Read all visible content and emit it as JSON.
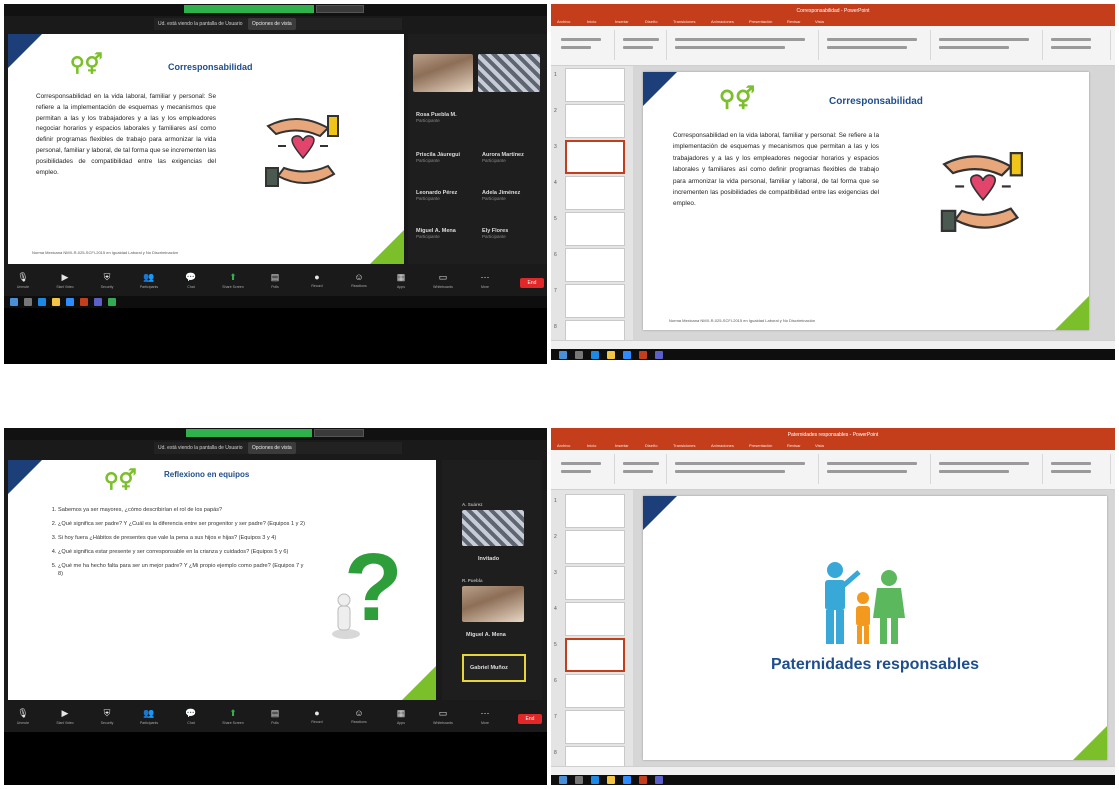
{
  "top": {
    "zoom": {
      "share_bar": {
        "text": "Ud. está viendo la pantalla de Usuario",
        "pill": "Opciones de vista"
      },
      "slide": {
        "title": "Corresponsabilidad",
        "body": "Corresponsabilidad en la vida laboral, familiar y personal: Se refiere a la implementación de esquemas y mecanismos que permitan a las y los trabajadores y a las y los empleadores negociar horarios y espacios laborales y familiares así como definir programas flexibles de trabajo para armonizar la vida personal, familiar y laboral, de tal forma que se incrementen las posibilidades de compatibilidad entre las exigencias del empleo.",
        "footer": "Norma Mexicana NMX-R-025-SCFI-2015 en Igualdad Laboral y No Discriminación"
      },
      "participants": [
        {
          "name": "Rosa Puebla M.",
          "sub": "Participante"
        },
        {
          "name": "Priscila Jáuregui",
          "sub": "Participante"
        },
        {
          "name": "Leonardo Pérez",
          "sub": "Participante"
        },
        {
          "name": "Miguel A. Mena",
          "sub": "Participante"
        }
      ],
      "participants_right": [
        {
          "name": "",
          "sub": ""
        },
        {
          "name": "Aurora Martínez",
          "sub": "Participante"
        },
        {
          "name": "Adela Jiménez",
          "sub": "Participante"
        },
        {
          "name": "Ely Flores",
          "sub": "Participante"
        }
      ],
      "controls": [
        "Unmute",
        "Start Video",
        "Security",
        "Participants",
        "Chat",
        "Share Screen",
        "Polls",
        "Record",
        "Reactions",
        "Apps",
        "Whiteboards",
        "Notes",
        "More"
      ],
      "end_label": "End"
    },
    "ppt": {
      "window_title": "Corresponsabilidad - PowerPoint",
      "tabs": [
        "Archivo",
        "Inicio",
        "Insertar",
        "Diseño",
        "Transiciones",
        "Animaciones",
        "Presentación",
        "Revisar",
        "Vista"
      ],
      "slide": {
        "title": "Corresponsabilidad",
        "body": "Corresponsabilidad en la vida laboral, familiar y personal: Se refiere a la implementación de esquemas y mecanismos que permitan a las y los trabajadores y a las y los empleadores negociar horarios y espacios laborales y familiares así como definir programas flexibles de trabajo para armonizar la vida personal, familiar y laboral, de tal forma que se incrementen las posibilidades de compatibilidad entre las exigencias del empleo.",
        "footer": "Norma Mexicana NMX-R-025-SCFI-2015 en Igualdad Laboral y No Discriminación"
      },
      "thumb_numbers": [
        "1",
        "2",
        "3",
        "4",
        "5",
        "6",
        "7",
        "8"
      ]
    }
  },
  "bottom": {
    "zoom": {
      "share_bar": {
        "text": "Ud. está viendo la pantalla de Usuario",
        "pill": "Opciones de vista"
      },
      "slide": {
        "title": "Reflexiono en equipos",
        "questions": [
          "Sabemos ya ser mayores, ¿cómo describirían el rol de los papás?",
          "¿Qué significa ser padre? Y ¿Cuál es la diferencia entre ser progenitor y ser padre? (Equipos 1 y 2)",
          "Si hoy fuera ¿Hábitos de presentes que vale la pena a sus hijos e hijas? (Equipos 3 y 4)",
          "¿Qué significa estar presente y ser corresponsable en la crianza y cuidados? (Equipos 5 y 6)",
          "¿Qué me ha hecho falta para ser un mejor padre? Y ¿Mi propio ejemplo como padre? (Equipos 7 y 8)"
        ]
      },
      "participants": [
        {
          "name": "A. Suárez",
          "sub": ""
        },
        {
          "name": "Invitado",
          "sub": ""
        },
        {
          "name": "R. Puebla",
          "sub": ""
        },
        {
          "name": "Miguel A. Mena",
          "sub": ""
        },
        {
          "name": "Gabriel Muñoz",
          "sub": ""
        }
      ],
      "controls": [
        "Unmute",
        "Start Video",
        "Security",
        "Participants",
        "Chat",
        "Share Screen",
        "Polls",
        "Record",
        "Reactions",
        "Apps",
        "Whiteboards",
        "Notes",
        "More"
      ],
      "end_label": "End"
    },
    "ppt": {
      "window_title": "Paternidades responsables - PowerPoint",
      "tabs": [
        "Archivo",
        "Inicio",
        "Insertar",
        "Diseño",
        "Transiciones",
        "Animaciones",
        "Presentación",
        "Revisar",
        "Vista"
      ],
      "slide": {
        "heading": "Paternidades responsables"
      },
      "thumb_numbers": [
        "1",
        "2",
        "3",
        "4",
        "5",
        "6",
        "7",
        "8"
      ]
    }
  },
  "colors": {
    "ppt_red": "#c43e1c",
    "slide_blue": "#1c3f7a",
    "slide_green": "#7bbf2a",
    "zoom_bg": "#1a1a1a",
    "end_red": "#e02828"
  },
  "icons": [
    "gender-symbols-icon",
    "hands-heart-icon",
    "question-mark-icon",
    "family-icon",
    "microphone-icon",
    "video-icon",
    "shield-icon",
    "participants-icon",
    "chat-icon",
    "share-screen-icon",
    "record-icon",
    "reactions-icon",
    "more-icon"
  ]
}
